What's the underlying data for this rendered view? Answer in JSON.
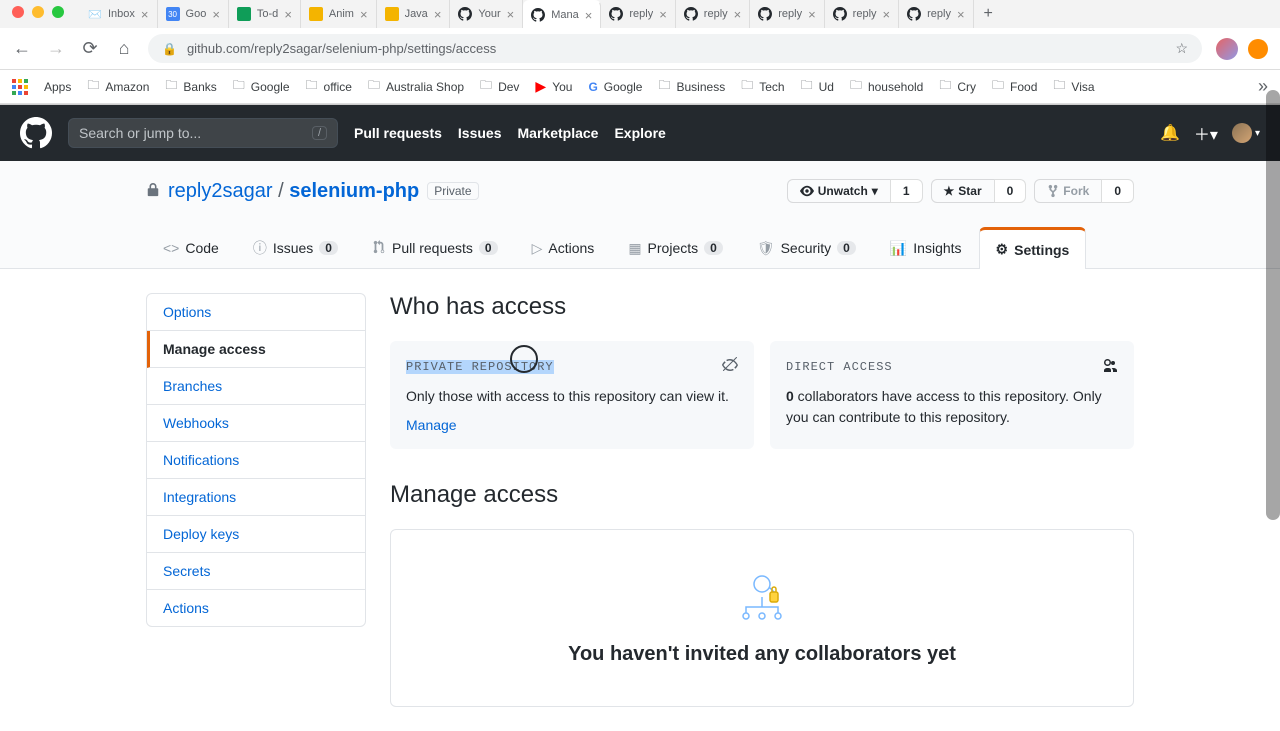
{
  "browser": {
    "tabs": [
      {
        "title": "Inbox",
        "favicon": "gmail"
      },
      {
        "title": "Goo",
        "favicon": "gcal"
      },
      {
        "title": "To-d",
        "favicon": "gsheet"
      },
      {
        "title": "Anim",
        "favicon": "gslides"
      },
      {
        "title": "Java",
        "favicon": "gslides"
      },
      {
        "title": "Your",
        "favicon": "github"
      },
      {
        "title": "Mana",
        "favicon": "github",
        "active": true
      },
      {
        "title": "reply",
        "favicon": "github"
      },
      {
        "title": "reply",
        "favicon": "github"
      },
      {
        "title": "reply",
        "favicon": "github"
      },
      {
        "title": "reply",
        "favicon": "github"
      },
      {
        "title": "reply",
        "favicon": "github"
      }
    ],
    "url": "github.com/reply2sagar/selenium-php/settings/access",
    "apps_label": "Apps",
    "bookmarks": [
      {
        "label": "Amazon",
        "icon": "folder"
      },
      {
        "label": "Banks",
        "icon": "folder"
      },
      {
        "label": "Google",
        "icon": "folder"
      },
      {
        "label": "office",
        "icon": "folder"
      },
      {
        "label": "Australia Shop",
        "icon": "folder"
      },
      {
        "label": "Dev",
        "icon": "folder"
      },
      {
        "label": "You",
        "icon": "youtube"
      },
      {
        "label": "Google",
        "icon": "google"
      },
      {
        "label": "Business",
        "icon": "folder"
      },
      {
        "label": "Tech",
        "icon": "folder"
      },
      {
        "label": "Ud",
        "icon": "folder"
      },
      {
        "label": "household",
        "icon": "folder"
      },
      {
        "label": "Cry",
        "icon": "folder"
      },
      {
        "label": "Food",
        "icon": "folder"
      },
      {
        "label": "Visa",
        "icon": "folder"
      }
    ]
  },
  "gh": {
    "search_placeholder": "Search or jump to...",
    "nav": {
      "pulls": "Pull requests",
      "issues": "Issues",
      "marketplace": "Marketplace",
      "explore": "Explore"
    }
  },
  "repo": {
    "owner": "reply2sagar",
    "name": "selenium-php",
    "visibility": "Private",
    "actions": {
      "unwatch": "Unwatch",
      "unwatch_count": "1",
      "star": "Star",
      "star_count": "0",
      "fork": "Fork",
      "fork_count": "0"
    },
    "tabs": {
      "code": "Code",
      "issues": "Issues",
      "issues_count": "0",
      "pulls": "Pull requests",
      "pulls_count": "0",
      "actions": "Actions",
      "projects": "Projects",
      "projects_count": "0",
      "security": "Security",
      "security_count": "0",
      "insights": "Insights",
      "settings": "Settings"
    }
  },
  "sidebar": {
    "items": [
      "Options",
      "Manage access",
      "Branches",
      "Webhooks",
      "Notifications",
      "Integrations",
      "Deploy keys",
      "Secrets",
      "Actions"
    ],
    "active_index": 1
  },
  "content": {
    "who_title": "Who has access",
    "private_card": {
      "label": "PRIVATE REPOSITORY",
      "text": "Only those with access to this repository can view it.",
      "link": "Manage"
    },
    "direct_card": {
      "label": "DIRECT ACCESS",
      "count": "0",
      "text_after": " collaborators have access to this repository. Only you can contribute to this repository."
    },
    "manage_title": "Manage access",
    "empty_title": "You haven't invited any collaborators yet"
  }
}
